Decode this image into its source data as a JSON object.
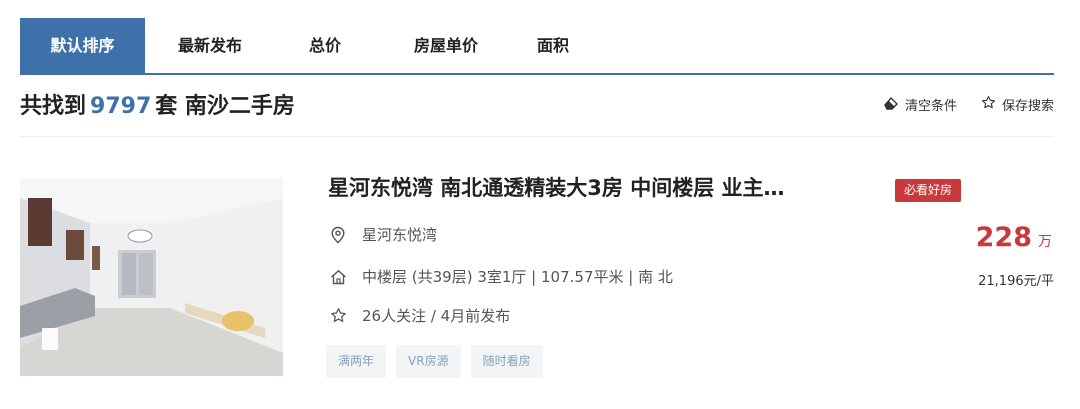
{
  "tabs": [
    "默认排序",
    "最新发布",
    "总价",
    "房屋单价",
    "面积"
  ],
  "summary": {
    "prefix": "共找到",
    "count": "9797",
    "suffix": "套  南沙二手房"
  },
  "actions": {
    "clear": "清空条件",
    "save": "保存搜索"
  },
  "listing": {
    "title": "星河东悦湾 南北通透精装大3房 中间楼层 业主…",
    "badge": "必看好房",
    "community": "星河东悦湾",
    "details": "中楼层 (共39层) 3室1厅 | 107.57平米 | 南 北",
    "followers": "26人关注 / 4月前发布",
    "tags": [
      "满两年",
      "VR房源",
      "随时看房"
    ],
    "price": "228",
    "price_unit": "万",
    "unit_price": "21,196元/平"
  },
  "colors": {
    "accent": "#3e71a9",
    "price": "#c9383a",
    "tag_bg": "#f2f5f8"
  },
  "icons": {
    "clear": "eraser-icon",
    "save": "star-outline-icon",
    "location": "location-pin-icon",
    "house": "house-icon",
    "follow": "star-outline-icon"
  }
}
